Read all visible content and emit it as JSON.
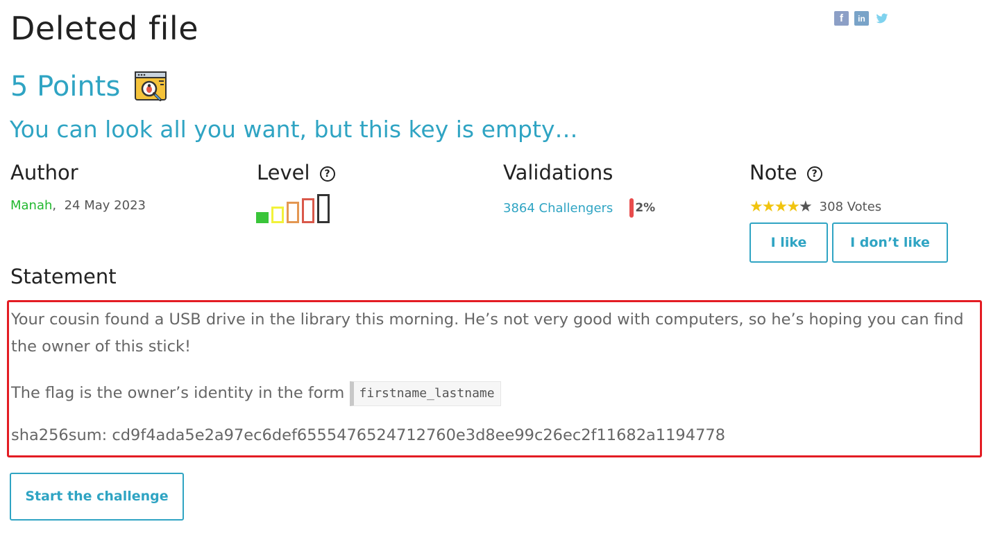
{
  "challenge": {
    "title": "Deleted file",
    "points": "5 Points",
    "category_icon": "bug-search-icon",
    "subtitle": "You can look all you want, but this key is empty…"
  },
  "share": {
    "facebook": "f",
    "linkedin": "in",
    "twitter": "t"
  },
  "author": {
    "heading": "Author",
    "name": "Manah",
    "separator": ",",
    "date": "24 May 2023"
  },
  "level": {
    "heading": "Level",
    "help": "?",
    "current": 1,
    "max": 5
  },
  "validations": {
    "heading": "Validations",
    "challengers": "3864 Challengers",
    "percent": "2%",
    "bar_color": "#e84c4c"
  },
  "note": {
    "heading": "Note",
    "help": "?",
    "rating": 4,
    "max_rating": 5,
    "votes": "308 Votes",
    "like_label": "I like",
    "dislike_label": "I don’t like"
  },
  "statement": {
    "heading": "Statement",
    "paragraph1": "Your cousin found a USB drive in the library this morning. He’s not very good with computers, so he’s hoping you can find the owner of this stick!",
    "paragraph2": "The flag is the owner’s identity in the form",
    "flag_format": "firstname_lastname",
    "sha_label": "sha256sum: cd9f4ada5e2a97ec6def6555476524712760e3d8ee99c26ec2f11682a1194778"
  },
  "actions": {
    "start_label": "Start the challenge"
  },
  "colors": {
    "accent": "#2fa4c3",
    "author_name": "#22b830",
    "highlight_border": "#e31c23"
  }
}
